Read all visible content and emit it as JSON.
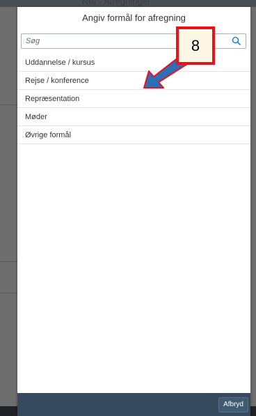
{
  "modal": {
    "title": "Angiv formål for afregning",
    "search": {
      "placeholder": "Søg",
      "value": ""
    },
    "items": [
      {
        "label": "Uddannelse / kursus"
      },
      {
        "label": "Rejse / konference"
      },
      {
        "label": "Repræsentation"
      },
      {
        "label": "Møder"
      },
      {
        "label": "Øvrige formål"
      }
    ],
    "cancel_label": "Afbryd"
  },
  "annotation": {
    "step_number": "8"
  },
  "background": {
    "title": "Ret - Afregninger"
  },
  "colors": {
    "footer": "#354a5f",
    "callout_border": "#e8121a",
    "arrow_fill": "#2f6db5",
    "arrow_outline": "#e8121a"
  }
}
